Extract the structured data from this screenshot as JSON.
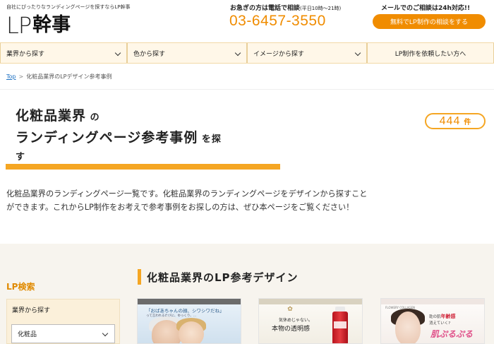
{
  "header": {
    "tagline": "自社にぴったりなランディングページを探すならLP幹事",
    "logo_lp": "LP",
    "logo_kanji": "幹事",
    "phone_label": "お急ぎの方は電話で相談",
    "phone_hours": "(平日10時〜21時)",
    "phone_number": "03-6457-3550",
    "mail_label": "メールでのご相談は24h対応!!",
    "mail_button": "無料でLP制作の相談をする"
  },
  "nav": {
    "items": [
      {
        "label": "業界から探す"
      },
      {
        "label": "色から探す"
      },
      {
        "label": "イメージから探す"
      },
      {
        "label": "LP制作を依頼したい方へ"
      }
    ]
  },
  "breadcrumb": {
    "home": "Top",
    "separator": ">",
    "current": "化粧品業界のLPデザイン参考事例"
  },
  "title": {
    "line1_big": "化粧品業界",
    "line1_small": "の",
    "line2_big": "ランディングページ参考事例",
    "line2_small": "を探",
    "line3_small": "す"
  },
  "count": {
    "number": "444",
    "unit": "件"
  },
  "intro": "化粧品業界のランディングページ一覧です。化粧品業界のランディングページをデザインから探すことができます。これからLP制作をお考えで参考事例をお探しの方は、ぜひ本ページをご覧ください！",
  "sidebar": {
    "search_label": "LP検索",
    "box_title": "業界から探す",
    "select_value": "化粧品"
  },
  "section": {
    "heading": "化粧品業界のLP参考デザイン"
  },
  "cards": [
    {
      "headline": "「おばあちゃんの顔、シワシワだね」",
      "subline": "って言われるたびに、ゆっくり、…"
    },
    {
      "headline_small": "気休めじゃない。",
      "headline_large": "本物の透明感"
    },
    {
      "brand": "FLOWERY COLLAGEN",
      "text_prefix": "乾の肌",
      "text_red": "年齢感",
      "text_suffix": "消えていく?",
      "big": "肌ぷるぷる"
    }
  ],
  "colors": {
    "accent": "#f5a623",
    "orange_text": "#f08c00",
    "link": "#1a6fc2",
    "nav_bg": "#fff7e8",
    "lower_bg": "#f7f4ee"
  }
}
